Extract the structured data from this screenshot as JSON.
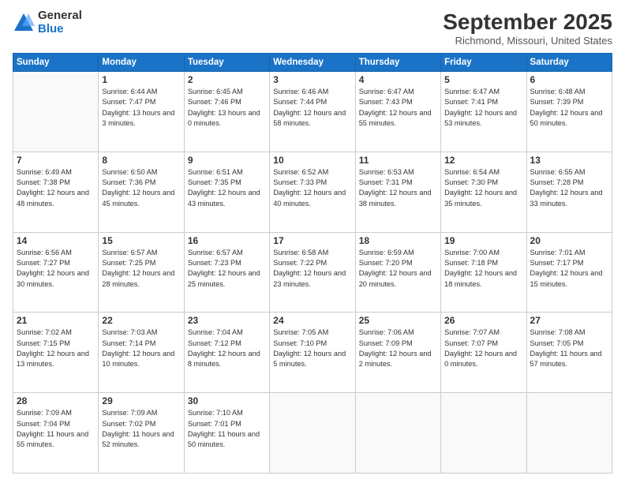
{
  "header": {
    "logo_general": "General",
    "logo_blue": "Blue",
    "month_title": "September 2025",
    "location": "Richmond, Missouri, United States"
  },
  "days_of_week": [
    "Sunday",
    "Monday",
    "Tuesday",
    "Wednesday",
    "Thursday",
    "Friday",
    "Saturday"
  ],
  "weeks": [
    [
      {
        "day": "",
        "sunrise": "",
        "sunset": "",
        "daylight": ""
      },
      {
        "day": "1",
        "sunrise": "Sunrise: 6:44 AM",
        "sunset": "Sunset: 7:47 PM",
        "daylight": "Daylight: 13 hours and 3 minutes."
      },
      {
        "day": "2",
        "sunrise": "Sunrise: 6:45 AM",
        "sunset": "Sunset: 7:46 PM",
        "daylight": "Daylight: 13 hours and 0 minutes."
      },
      {
        "day": "3",
        "sunrise": "Sunrise: 6:46 AM",
        "sunset": "Sunset: 7:44 PM",
        "daylight": "Daylight: 12 hours and 58 minutes."
      },
      {
        "day": "4",
        "sunrise": "Sunrise: 6:47 AM",
        "sunset": "Sunset: 7:43 PM",
        "daylight": "Daylight: 12 hours and 55 minutes."
      },
      {
        "day": "5",
        "sunrise": "Sunrise: 6:47 AM",
        "sunset": "Sunset: 7:41 PM",
        "daylight": "Daylight: 12 hours and 53 minutes."
      },
      {
        "day": "6",
        "sunrise": "Sunrise: 6:48 AM",
        "sunset": "Sunset: 7:39 PM",
        "daylight": "Daylight: 12 hours and 50 minutes."
      }
    ],
    [
      {
        "day": "7",
        "sunrise": "Sunrise: 6:49 AM",
        "sunset": "Sunset: 7:38 PM",
        "daylight": "Daylight: 12 hours and 48 minutes."
      },
      {
        "day": "8",
        "sunrise": "Sunrise: 6:50 AM",
        "sunset": "Sunset: 7:36 PM",
        "daylight": "Daylight: 12 hours and 45 minutes."
      },
      {
        "day": "9",
        "sunrise": "Sunrise: 6:51 AM",
        "sunset": "Sunset: 7:35 PM",
        "daylight": "Daylight: 12 hours and 43 minutes."
      },
      {
        "day": "10",
        "sunrise": "Sunrise: 6:52 AM",
        "sunset": "Sunset: 7:33 PM",
        "daylight": "Daylight: 12 hours and 40 minutes."
      },
      {
        "day": "11",
        "sunrise": "Sunrise: 6:53 AM",
        "sunset": "Sunset: 7:31 PM",
        "daylight": "Daylight: 12 hours and 38 minutes."
      },
      {
        "day": "12",
        "sunrise": "Sunrise: 6:54 AM",
        "sunset": "Sunset: 7:30 PM",
        "daylight": "Daylight: 12 hours and 35 minutes."
      },
      {
        "day": "13",
        "sunrise": "Sunrise: 6:55 AM",
        "sunset": "Sunset: 7:28 PM",
        "daylight": "Daylight: 12 hours and 33 minutes."
      }
    ],
    [
      {
        "day": "14",
        "sunrise": "Sunrise: 6:56 AM",
        "sunset": "Sunset: 7:27 PM",
        "daylight": "Daylight: 12 hours and 30 minutes."
      },
      {
        "day": "15",
        "sunrise": "Sunrise: 6:57 AM",
        "sunset": "Sunset: 7:25 PM",
        "daylight": "Daylight: 12 hours and 28 minutes."
      },
      {
        "day": "16",
        "sunrise": "Sunrise: 6:57 AM",
        "sunset": "Sunset: 7:23 PM",
        "daylight": "Daylight: 12 hours and 25 minutes."
      },
      {
        "day": "17",
        "sunrise": "Sunrise: 6:58 AM",
        "sunset": "Sunset: 7:22 PM",
        "daylight": "Daylight: 12 hours and 23 minutes."
      },
      {
        "day": "18",
        "sunrise": "Sunrise: 6:59 AM",
        "sunset": "Sunset: 7:20 PM",
        "daylight": "Daylight: 12 hours and 20 minutes."
      },
      {
        "day": "19",
        "sunrise": "Sunrise: 7:00 AM",
        "sunset": "Sunset: 7:18 PM",
        "daylight": "Daylight: 12 hours and 18 minutes."
      },
      {
        "day": "20",
        "sunrise": "Sunrise: 7:01 AM",
        "sunset": "Sunset: 7:17 PM",
        "daylight": "Daylight: 12 hours and 15 minutes."
      }
    ],
    [
      {
        "day": "21",
        "sunrise": "Sunrise: 7:02 AM",
        "sunset": "Sunset: 7:15 PM",
        "daylight": "Daylight: 12 hours and 13 minutes."
      },
      {
        "day": "22",
        "sunrise": "Sunrise: 7:03 AM",
        "sunset": "Sunset: 7:14 PM",
        "daylight": "Daylight: 12 hours and 10 minutes."
      },
      {
        "day": "23",
        "sunrise": "Sunrise: 7:04 AM",
        "sunset": "Sunset: 7:12 PM",
        "daylight": "Daylight: 12 hours and 8 minutes."
      },
      {
        "day": "24",
        "sunrise": "Sunrise: 7:05 AM",
        "sunset": "Sunset: 7:10 PM",
        "daylight": "Daylight: 12 hours and 5 minutes."
      },
      {
        "day": "25",
        "sunrise": "Sunrise: 7:06 AM",
        "sunset": "Sunset: 7:09 PM",
        "daylight": "Daylight: 12 hours and 2 minutes."
      },
      {
        "day": "26",
        "sunrise": "Sunrise: 7:07 AM",
        "sunset": "Sunset: 7:07 PM",
        "daylight": "Daylight: 12 hours and 0 minutes."
      },
      {
        "day": "27",
        "sunrise": "Sunrise: 7:08 AM",
        "sunset": "Sunset: 7:05 PM",
        "daylight": "Daylight: 11 hours and 57 minutes."
      }
    ],
    [
      {
        "day": "28",
        "sunrise": "Sunrise: 7:09 AM",
        "sunset": "Sunset: 7:04 PM",
        "daylight": "Daylight: 11 hours and 55 minutes."
      },
      {
        "day": "29",
        "sunrise": "Sunrise: 7:09 AM",
        "sunset": "Sunset: 7:02 PM",
        "daylight": "Daylight: 11 hours and 52 minutes."
      },
      {
        "day": "30",
        "sunrise": "Sunrise: 7:10 AM",
        "sunset": "Sunset: 7:01 PM",
        "daylight": "Daylight: 11 hours and 50 minutes."
      },
      {
        "day": "",
        "sunrise": "",
        "sunset": "",
        "daylight": ""
      },
      {
        "day": "",
        "sunrise": "",
        "sunset": "",
        "daylight": ""
      },
      {
        "day": "",
        "sunrise": "",
        "sunset": "",
        "daylight": ""
      },
      {
        "day": "",
        "sunrise": "",
        "sunset": "",
        "daylight": ""
      }
    ]
  ]
}
